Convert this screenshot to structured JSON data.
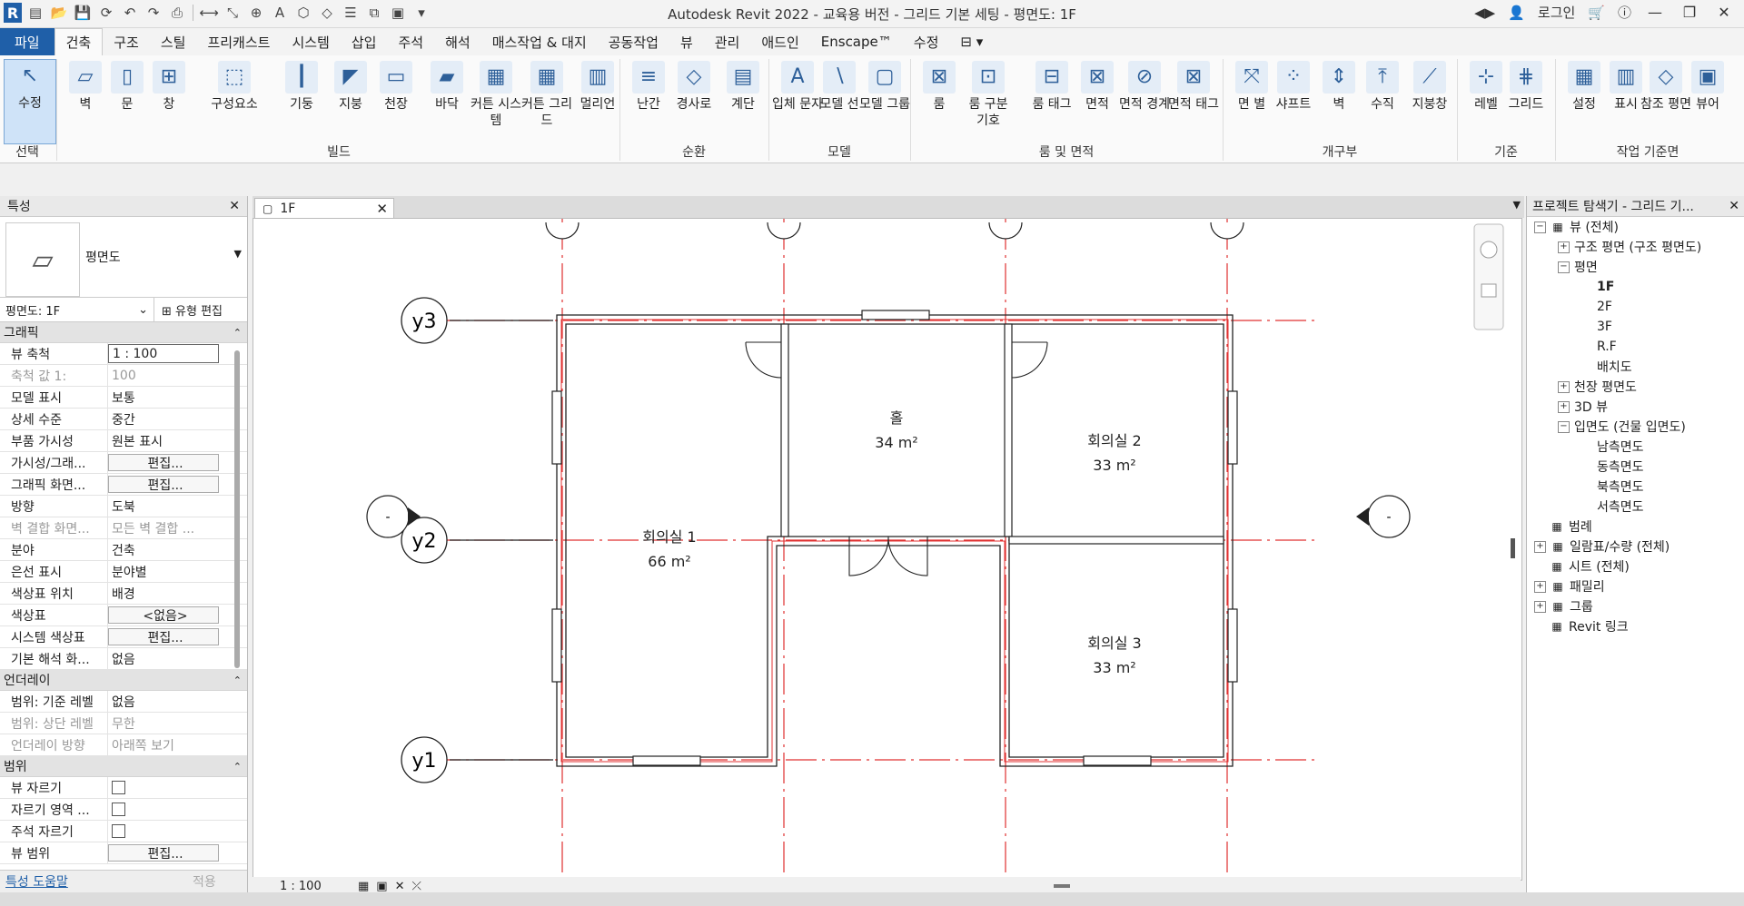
{
  "titlebar": {
    "logo": "R",
    "title": "Autodesk Revit 2022 - 교육용 버전 - 그리드 기본 세팅 - 평면도: 1F",
    "login": "로그인"
  },
  "ribbon_tabs": [
    "파일",
    "건축",
    "구조",
    "스틸",
    "프리캐스트",
    "시스템",
    "삽입",
    "주석",
    "해석",
    "매스작업 & 대지",
    "공동작업",
    "뷰",
    "관리",
    "애드인",
    "Enscape™",
    "수정"
  ],
  "ribbon": {
    "select": "수정",
    "select_group": "선택",
    "build": [
      "벽",
      "문",
      "창",
      "구성요소",
      "기둥",
      "지붕",
      "천장",
      "바닥",
      "커튼 시스템",
      "커튼 그리드",
      "멀리언"
    ],
    "build_group": "빌드",
    "circulation": [
      "난간",
      "경사로",
      "계단"
    ],
    "circulation_group": "순환",
    "model": [
      "입체 문자",
      "모델 선",
      "모델 그룹"
    ],
    "model_group": "모델",
    "room": [
      "룸",
      "룸 구분 기호",
      "룸 태그",
      "면적",
      "면적 경계",
      "면적 태그"
    ],
    "room_group": "룸 및 면적",
    "opening": [
      "면 별",
      "샤프트",
      "벽",
      "수직",
      "지붕창"
    ],
    "opening_group": "개구부",
    "datum": [
      "레벨",
      "그리드"
    ],
    "datum_group": "기준",
    "workplane": [
      "설정",
      "표시",
      "참조 평면",
      "뷰어"
    ],
    "workplane_group": "작업 기준면"
  },
  "properties": {
    "title": "특성",
    "type_name": "평면도",
    "view_selector": "평면도: 1F",
    "edit_type": "유형 편집",
    "categories": {
      "graphics": "그래픽",
      "underlay": "언더레이",
      "extents": "범위"
    },
    "graphics_rows": [
      {
        "k": "뷰 축척",
        "v": "1 : 100",
        "style": "box"
      },
      {
        "k": "축척 값    1:",
        "v": "100",
        "style": "dim"
      },
      {
        "k": "모델 표시",
        "v": "보통"
      },
      {
        "k": "상세 수준",
        "v": "중간"
      },
      {
        "k": "부품 가시성",
        "v": "원본 표시"
      },
      {
        "k": "가시성/그래...",
        "v": "편집...",
        "style": "btn"
      },
      {
        "k": "그래픽 화면...",
        "v": "편집...",
        "style": "btn"
      },
      {
        "k": "방향",
        "v": "도북"
      },
      {
        "k": "벽 결합 화면...",
        "v": "모든 벽 결합 ...",
        "style": "dim"
      },
      {
        "k": "분야",
        "v": "건축"
      },
      {
        "k": "은선 표시",
        "v": "분야별"
      },
      {
        "k": "색상표 위치",
        "v": "배경"
      },
      {
        "k": "색상표",
        "v": "<없음>",
        "style": "btn"
      },
      {
        "k": "시스템 색상표",
        "v": "편집...",
        "style": "btn"
      },
      {
        "k": "기본 해석 화...",
        "v": "없음"
      }
    ],
    "underlay_rows": [
      {
        "k": "범위: 기준 레벨",
        "v": "없음"
      },
      {
        "k": "범위: 상단 레벨",
        "v": "무한",
        "style": "dim"
      },
      {
        "k": "언더레이 방향",
        "v": "아래쪽 보기",
        "style": "dim"
      }
    ],
    "extents_rows": [
      {
        "k": "뷰 자르기",
        "v": "",
        "style": "chk"
      },
      {
        "k": "자르기 영역 ...",
        "v": "",
        "style": "chk"
      },
      {
        "k": "주석 자르기",
        "v": "",
        "style": "chk"
      },
      {
        "k": "뷰 범위",
        "v": "편집...",
        "style": "btn"
      }
    ],
    "help": "특성 도움말",
    "apply": "적용"
  },
  "view": {
    "tab_label": "1F",
    "scale": "1 : 100"
  },
  "plan": {
    "grid_labels": [
      "y3",
      "y2",
      "y1"
    ],
    "elevation_marker": "-",
    "rooms": [
      {
        "name": "홀",
        "area": "34 m²"
      },
      {
        "name": "회의실 2",
        "area": "33 m²"
      },
      {
        "name": "회의실 1",
        "area": "66 m²"
      },
      {
        "name": "회의실 3",
        "area": "33 m²"
      }
    ]
  },
  "browser": {
    "title": "프로젝트 탐색기 - 그리드 기...",
    "items": [
      {
        "label": "뷰 (전체)",
        "level": 0,
        "exp": "−"
      },
      {
        "label": "구조 평면 (구조 평면도)",
        "level": 1,
        "exp": "+"
      },
      {
        "label": "평면",
        "level": 1,
        "exp": "−"
      },
      {
        "label": "1F",
        "level": 2,
        "bold": true
      },
      {
        "label": "2F",
        "level": 2
      },
      {
        "label": "3F",
        "level": 2
      },
      {
        "label": "R.F",
        "level": 2
      },
      {
        "label": "배치도",
        "level": 2
      },
      {
        "label": "천장 평면도",
        "level": 1,
        "exp": "+"
      },
      {
        "label": "3D 뷰",
        "level": 1,
        "exp": "+"
      },
      {
        "label": "입면도 (건물 입면도)",
        "level": 1,
        "exp": "−"
      },
      {
        "label": "남측면도",
        "level": 2
      },
      {
        "label": "동측면도",
        "level": 2
      },
      {
        "label": "북측면도",
        "level": 2
      },
      {
        "label": "서측면도",
        "level": 2
      },
      {
        "label": "범례",
        "level": 0
      },
      {
        "label": "일람표/수량 (전체)",
        "level": 0,
        "exp": "+"
      },
      {
        "label": "시트 (전체)",
        "level": 0
      },
      {
        "label": "패밀리",
        "level": 0,
        "exp": "+"
      },
      {
        "label": "그룹",
        "level": 0,
        "exp": "+"
      },
      {
        "label": "Revit 링크",
        "level": 0
      }
    ]
  },
  "colors": {
    "accent": "#1f5fa8",
    "grid_line": "#e03030"
  }
}
